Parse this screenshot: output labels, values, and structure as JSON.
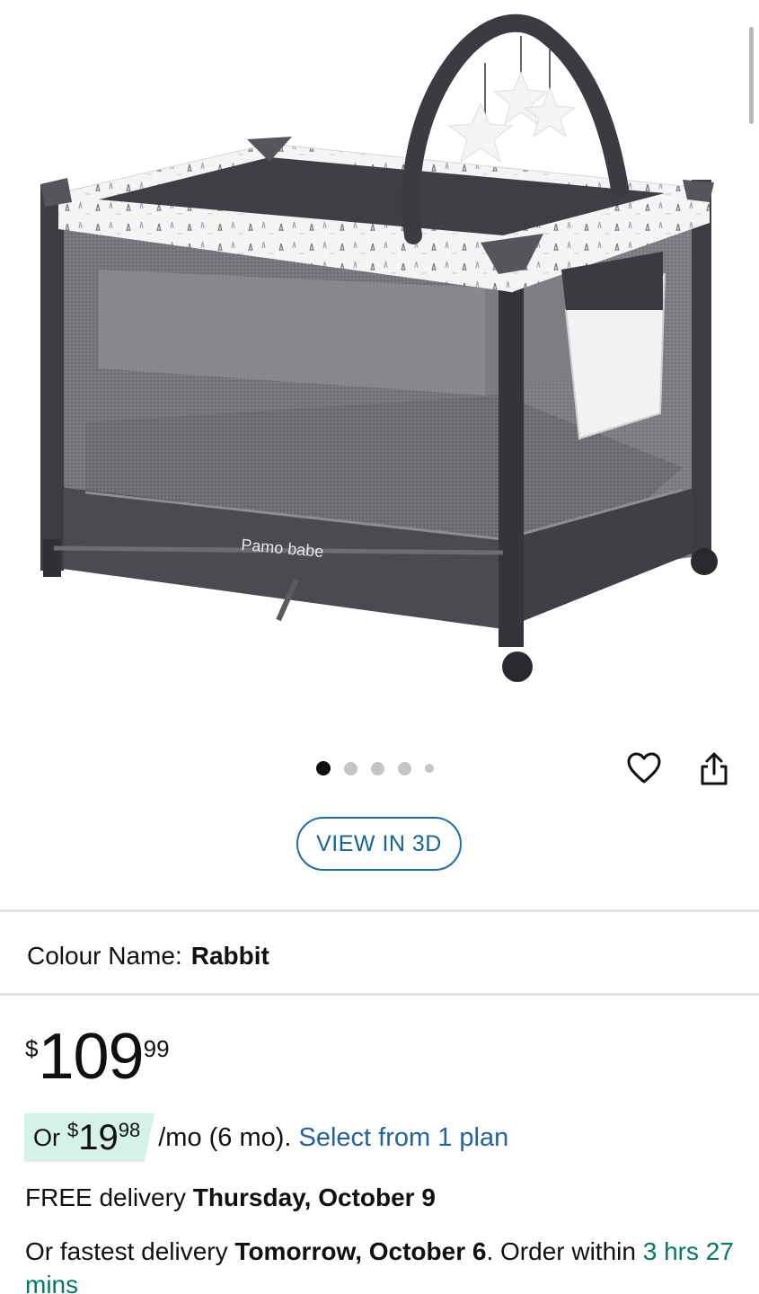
{
  "product": {
    "image_alt": "Pamo babe playard crib in grey with rabbit print and toy arch",
    "brand_print": "Pamo babe",
    "gallery": {
      "total": 5,
      "active_index": 0
    }
  },
  "actions": {
    "wishlist_icon": "heart-outline-icon",
    "share_icon": "share-icon",
    "view_3d_label": "VIEW IN 3D"
  },
  "colour": {
    "label": "Colour Name:",
    "value": "Rabbit"
  },
  "price": {
    "currency": "$",
    "whole": "109",
    "fraction": "99"
  },
  "monthly": {
    "prefix": "Or",
    "currency": "$",
    "whole": "19",
    "fraction": "98",
    "suffix": "/mo (6 mo).",
    "link": "Select from 1 plan"
  },
  "delivery": {
    "free_prefix": "FREE delivery",
    "free_date": "Thursday, October 9",
    "fast_prefix": "Or fastest delivery",
    "fast_date": "Tomorrow, October 6",
    "order_within": ". Order within",
    "countdown": "3 hrs 27 mins"
  },
  "colors": {
    "link_blue": "#2162a1",
    "button_border": "#1b6fa8",
    "badge_mint": "#d4f2ea",
    "countdown_green": "#007a65",
    "crib_fabric": "#4a4a50"
  }
}
